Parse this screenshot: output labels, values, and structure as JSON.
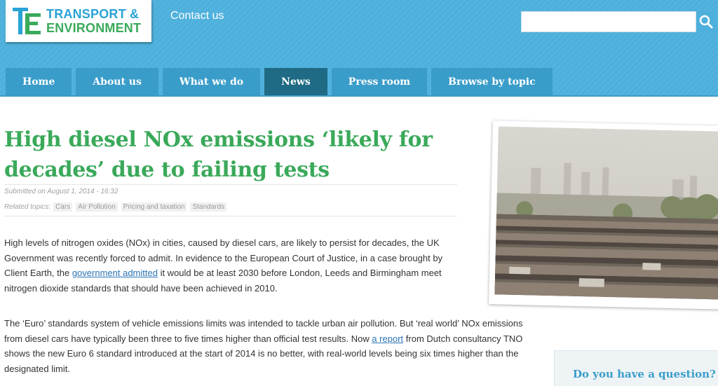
{
  "site": {
    "logo_line1": "TRANSPORT &",
    "logo_line2": "ENVIRONMENT",
    "contact_label": "Contact us",
    "search_placeholder": ""
  },
  "nav": {
    "items": [
      {
        "label": "Home"
      },
      {
        "label": "About us"
      },
      {
        "label": "What we do"
      },
      {
        "label": "News"
      },
      {
        "label": "Press room"
      },
      {
        "label": "Browse by topic"
      }
    ],
    "active_index": 3
  },
  "article": {
    "title": "High diesel NOx emissions ‘likely for decades’ due to failing tests",
    "submitted": "Submitted on August 1, 2014 - 16:32",
    "related_label": "Related topics:",
    "topics": [
      "Cars",
      "Air Pollution",
      "Pricing and taxation",
      "Standards"
    ],
    "p1_a": "High levels of nitrogen oxides (NOx) in cities, caused by diesel cars, are likely to persist for decades, the UK Government was recently forced to admit. In evidence to the European Court of Justice, in a case brought by Client Earth, the ",
    "p1_link": "government admitted",
    "p1_b": " it would be at least 2030 before London, Leeds and Birmingham meet nitrogen dioxide standards that should have been achieved in 2010.",
    "p2_a": "The ‘Euro’ standards system of vehicle emissions limits was intended to tackle urban air pollution. But ‘real world’ NOx emissions from diesel cars have typically been three to five times higher than official test results. Now ",
    "p2_link": "a report",
    "p2_b": " from Dutch consultancy TNO shows the new Euro 6 standard introduced at the start of 2014 is no better, with real-world levels being six times higher than the designated limit."
  },
  "sidebar": {
    "question": "Do you have a question?"
  },
  "colors": {
    "header_blue": "#4db0dc",
    "nav_tab": "#3a9dc9",
    "nav_active": "#1f6a85",
    "title_green": "#3aa95a",
    "link_blue": "#2a74b4"
  },
  "icons": {
    "logo": "te-logo-icon",
    "search": "search-icon"
  }
}
